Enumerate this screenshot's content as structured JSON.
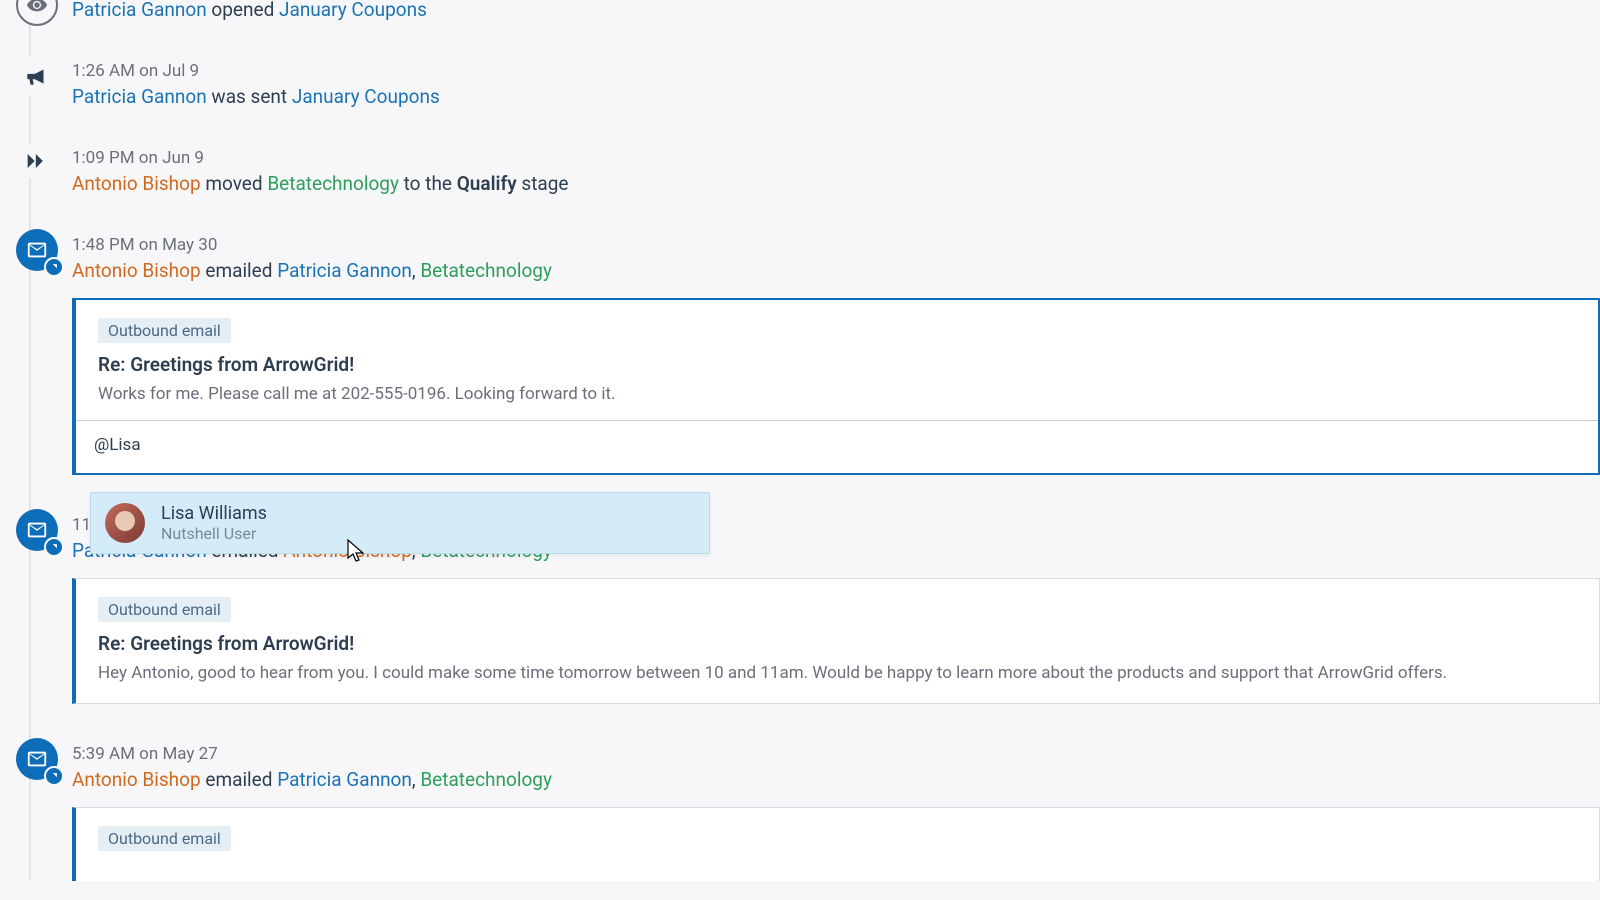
{
  "colors": {
    "blue_link": "#1b73b3",
    "orange_link": "#d16a1e",
    "green_link": "#2e9e5b"
  },
  "timeline": [
    {
      "icon": "eye",
      "ts": "",
      "parts": [
        {
          "t": "Patricia Gannon",
          "cls": "link-blue"
        },
        {
          "t": " opened ",
          "cls": ""
        },
        {
          "t": "January Coupons",
          "cls": "link-blue"
        }
      ]
    },
    {
      "icon": "megaphone",
      "ts": "1:26 AM on Jul 9",
      "parts": [
        {
          "t": "Patricia Gannon",
          "cls": "link-blue"
        },
        {
          "t": " was sent ",
          "cls": ""
        },
        {
          "t": "January Coupons",
          "cls": "link-blue"
        }
      ]
    },
    {
      "icon": "chevrons",
      "ts": "1:09 PM on Jun 9",
      "parts": [
        {
          "t": "Antonio Bishop",
          "cls": "link-orange"
        },
        {
          "t": " moved ",
          "cls": ""
        },
        {
          "t": "Betatechnology",
          "cls": "link-green"
        },
        {
          "t": " to the ",
          "cls": ""
        },
        {
          "t": "Qualify",
          "cls": "bold"
        },
        {
          "t": " stage",
          "cls": ""
        }
      ]
    },
    {
      "icon": "mail",
      "ts": "1:48 PM on May 30",
      "parts": [
        {
          "t": "Antonio Bishop",
          "cls": "link-orange"
        },
        {
          "t": " emailed ",
          "cls": ""
        },
        {
          "t": "Patricia Gannon",
          "cls": "link-blue"
        },
        {
          "t": ", ",
          "cls": ""
        },
        {
          "t": "Betatechnology",
          "cls": "link-green"
        }
      ],
      "card": {
        "badge": "Outbound email",
        "subject": "Re: Greetings from ArrowGrid!",
        "body": "Works for me. Please call me at 202-555-0196. Looking forward to it.",
        "comment": "@Lisa",
        "active": true
      }
    },
    {
      "icon": "mail",
      "ts": "11:",
      "parts": [
        {
          "t": "Patricia Gannon",
          "cls": "link-blue"
        },
        {
          "t": " emailed ",
          "cls": ""
        },
        {
          "t": "Antonio Bishop",
          "cls": "link-orange"
        },
        {
          "t": ", ",
          "cls": ""
        },
        {
          "t": "Betatechnology",
          "cls": "link-green"
        }
      ],
      "card": {
        "badge": "Outbound email",
        "subject": "Re: Greetings from ArrowGrid!",
        "body": "Hey Antonio, good to hear from you. I could make some time tomorrow between 10 and 11am. Would be happy to learn more about the products and support that ArrowGrid offers.",
        "active": false
      }
    },
    {
      "icon": "mail",
      "ts": "5:39 AM on May 27",
      "parts": [
        {
          "t": "Antonio Bishop",
          "cls": "link-orange"
        },
        {
          "t": " emailed ",
          "cls": ""
        },
        {
          "t": "Patricia Gannon",
          "cls": "link-blue"
        },
        {
          "t": ", ",
          "cls": ""
        },
        {
          "t": "Betatechnology",
          "cls": "link-green"
        }
      ],
      "card": {
        "badge": "Outbound email",
        "subject": "",
        "body": "",
        "active": false,
        "partial": true
      }
    }
  ],
  "mention": {
    "name": "Lisa Williams",
    "role": "Nutshell User"
  }
}
